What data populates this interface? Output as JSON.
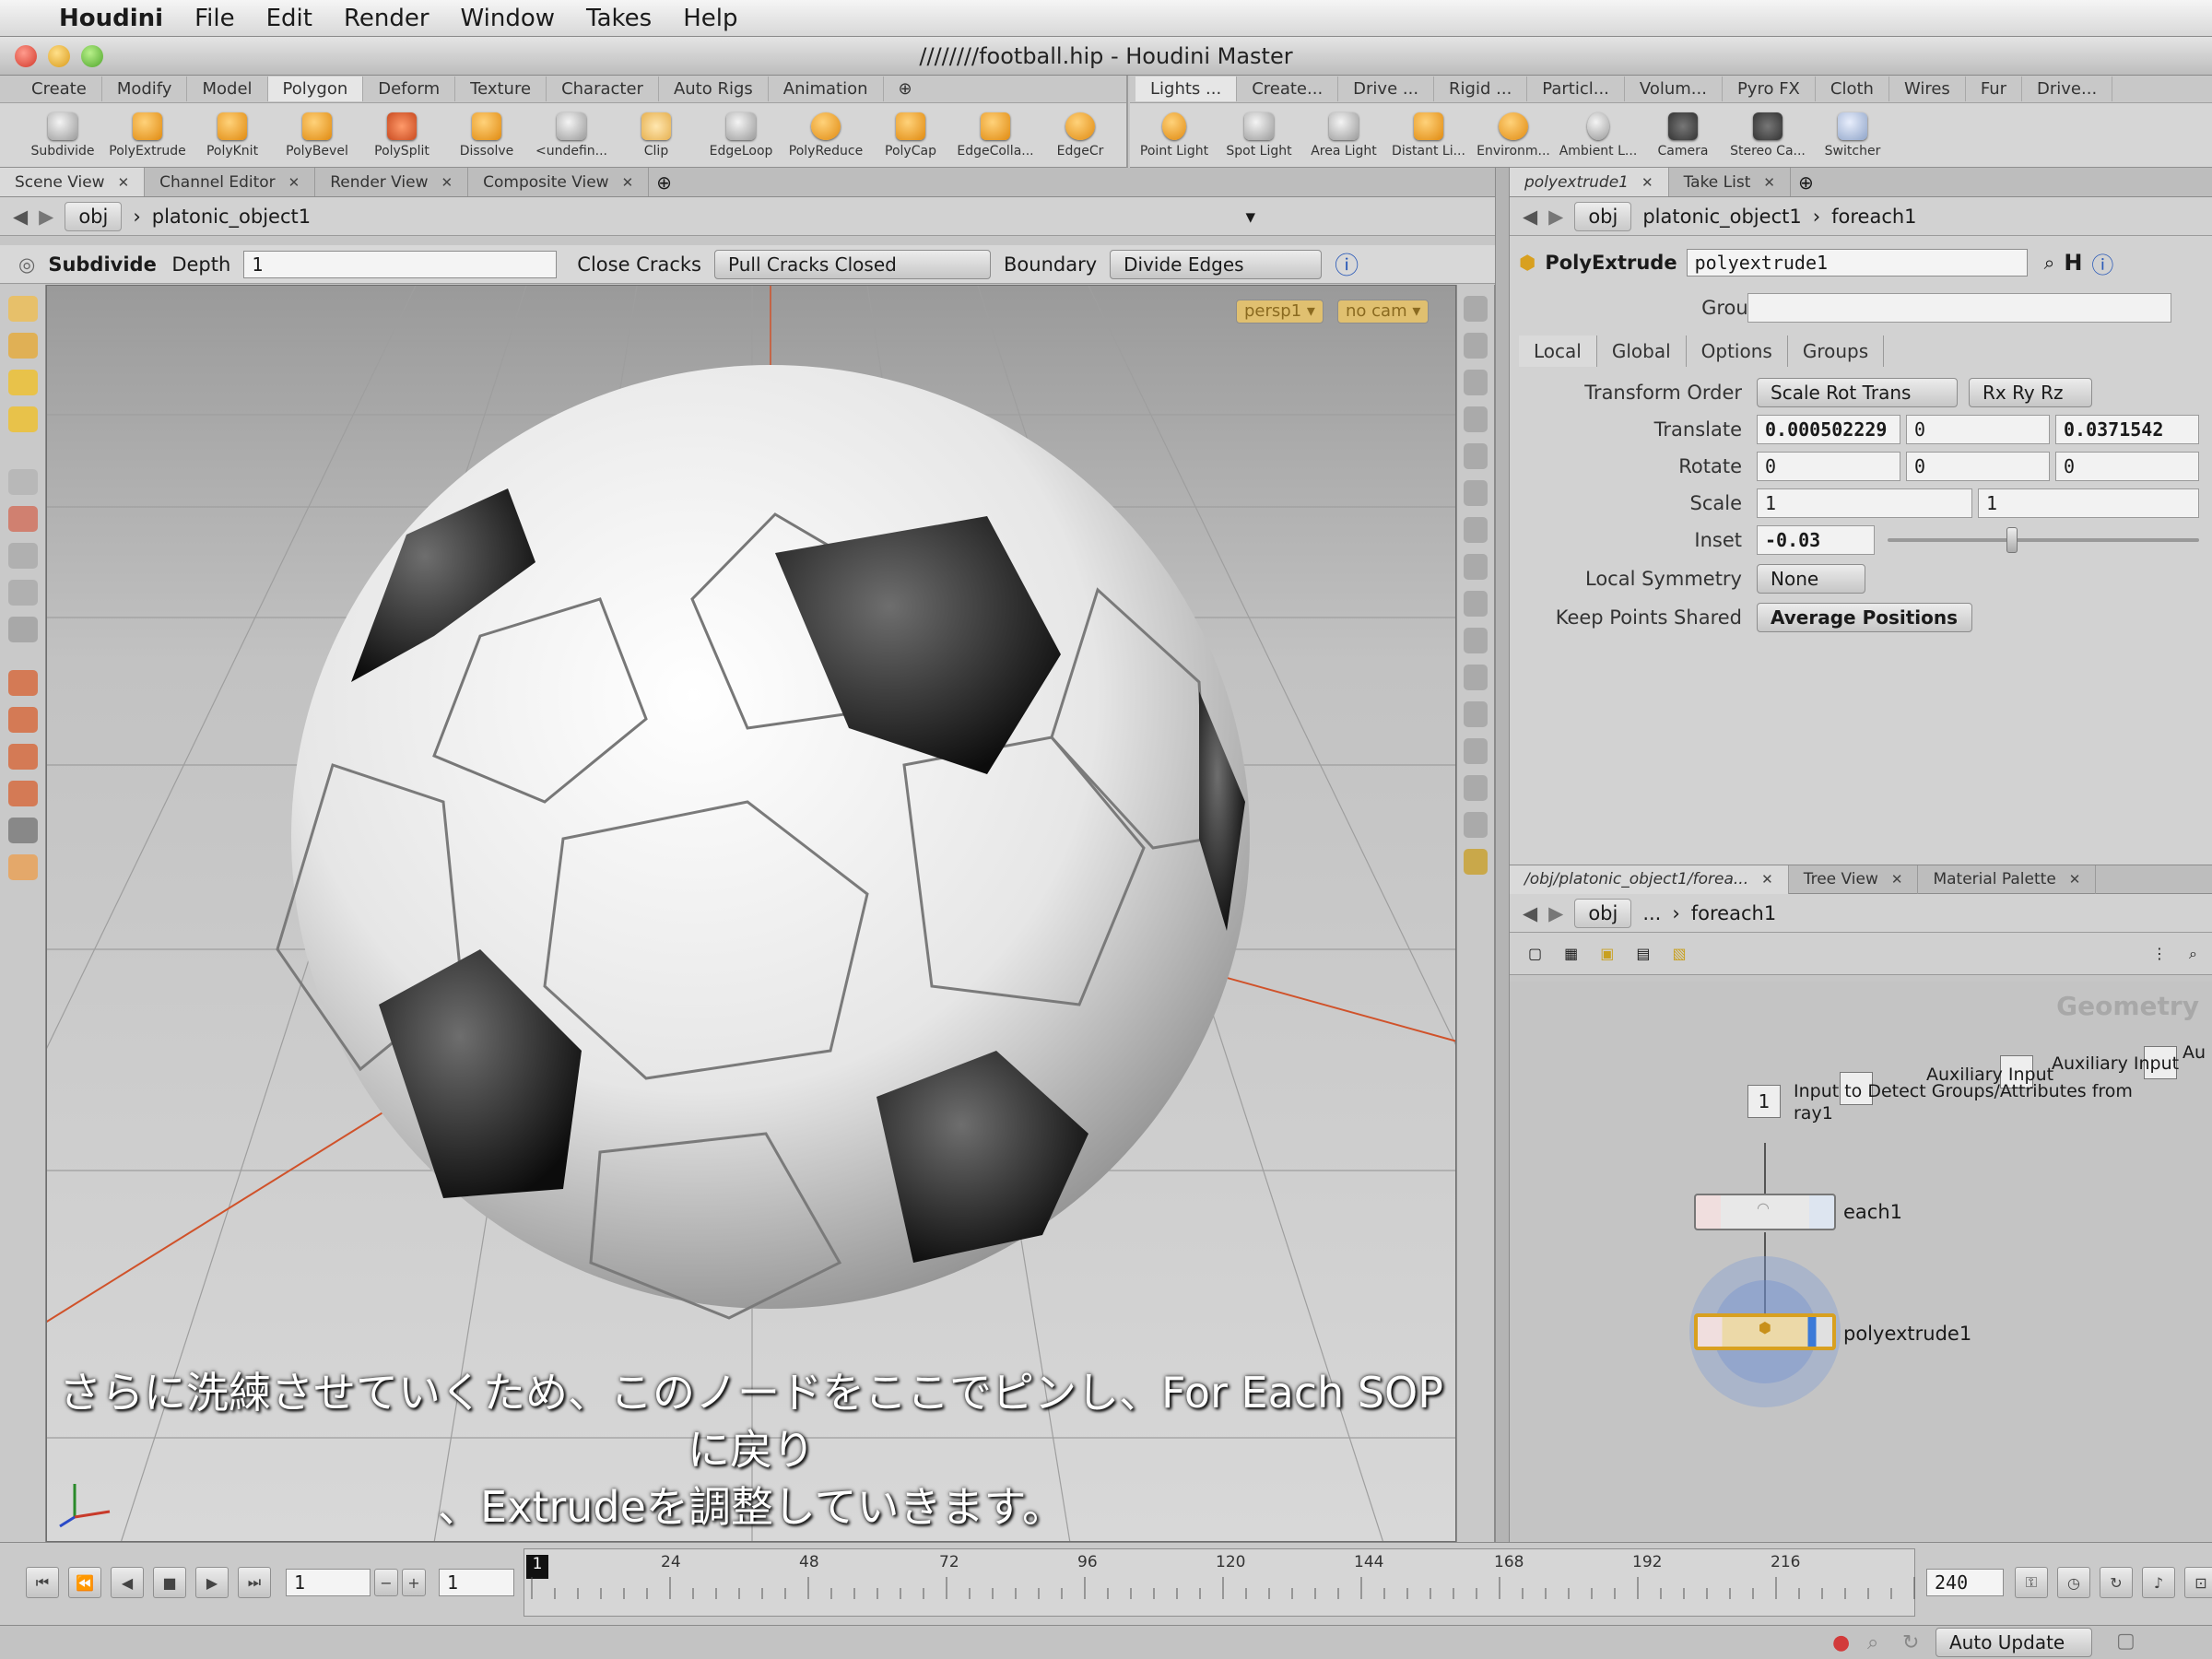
{
  "menubar": {
    "app": "Houdini",
    "items": [
      "File",
      "Edit",
      "Render",
      "Window",
      "Takes",
      "Help"
    ]
  },
  "window": {
    "title": "////////football.hip - Houdini Master"
  },
  "shelf_left": {
    "tabs": [
      "Create",
      "Modify",
      "Model",
      "Polygon",
      "Deform",
      "Texture",
      "Character",
      "Auto Rigs",
      "Animation"
    ],
    "selected": "Polygon",
    "tools": [
      "Subdivide",
      "PolyExtrude",
      "PolyKnit",
      "PolyBevel",
      "PolySplit",
      "Dissolve",
      "<undefin...",
      "Clip",
      "EdgeLoop",
      "PolyReduce",
      "PolyCap",
      "EdgeColla...",
      "EdgeCr"
    ]
  },
  "shelf_right": {
    "tabs": [
      "Lights ...",
      "Create...",
      "Drive ...",
      "Rigid ...",
      "Particl...",
      "Volum...",
      "Pyro FX",
      "Cloth",
      "Wires",
      "Fur",
      "Drive..."
    ],
    "tools": [
      "Point Light",
      "Spot Light",
      "Area Light",
      "Distant Li...",
      "Environm...",
      "Ambient L...",
      "Camera",
      "Stereo Ca...",
      "Switcher"
    ]
  },
  "left_pane": {
    "tabs": [
      "Scene View",
      "Channel Editor",
      "Render View",
      "Composite View"
    ],
    "path": {
      "root": "obj",
      "node": "platonic_object1"
    },
    "operator": {
      "name": "Subdivide",
      "depth_label": "Depth",
      "depth_value": "1",
      "close_cracks_label": "Close Cracks",
      "close_cracks_value": "Pull Cracks Closed",
      "boundary_label": "Boundary",
      "boundary_value": "Divide Edges"
    },
    "viewport": {
      "persp": "persp1 ▾",
      "cam": "no cam ▾"
    },
    "subtitle_line1": "さらに洗練させていくため、このノードをここでピンし、For Each SOPに戻り",
    "subtitle_line2": "、Extrudeを調整していきます。"
  },
  "params_pane": {
    "tabs": [
      "polyextrude1",
      "Take List"
    ],
    "path": {
      "root": "obj",
      "node1": "platonic_object1",
      "node2": "foreach1"
    },
    "node_type": "PolyExtrude",
    "node_name": "polyextrude1",
    "group_label": "Group",
    "subtabs": [
      "Local",
      "Global",
      "Options",
      "Groups"
    ],
    "transform_order_label": "Transform Order",
    "transform_order": "Scale Rot Trans",
    "rot_order": "Rx Ry Rz",
    "translate_label": "Translate",
    "translate": [
      "0.000502229",
      "0",
      "0.0371542"
    ],
    "rotate_label": "Rotate",
    "rotate": [
      "0",
      "0",
      "0"
    ],
    "scale_label": "Scale",
    "scale": [
      "1",
      "1"
    ],
    "inset_label": "Inset",
    "inset": "-0.03",
    "inset_fraction": 0.4,
    "local_symmetry_label": "Local Symmetry",
    "local_symmetry": "None",
    "keep_points_label": "Keep Points Shared",
    "keep_points": "Average Positions"
  },
  "network_pane": {
    "tabs": [
      "/obj/platonic_object1/forea...",
      "Tree View",
      "Material Palette"
    ],
    "path": {
      "root": "obj",
      "mid": "...",
      "node": "foreach1"
    },
    "context": "Geometry",
    "input_box": "1",
    "input_label": "Input to Detect Groups/Attributes from",
    "input_label2": "ray1",
    "aux1": "Auxiliary Input",
    "aux2": "Auxiliary Input",
    "aux3": "Au",
    "node1": "each1",
    "node2": "polyextrude1"
  },
  "timeline": {
    "frame": "1",
    "step": "1",
    "start_marker": "1",
    "ticks": [
      "24",
      "48",
      "72",
      "96",
      "120",
      "144",
      "168",
      "192",
      "216"
    ],
    "end": "240"
  },
  "status": {
    "auto_update": "Auto Update"
  }
}
